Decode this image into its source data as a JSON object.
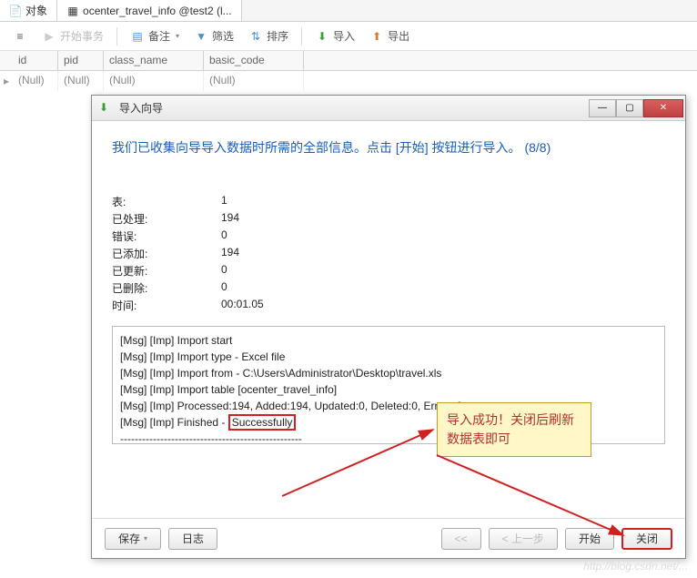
{
  "tabs": {
    "objects": "对象",
    "table": "ocenter_travel_info @test2 (l..."
  },
  "toolbar": {
    "menu": "≡",
    "begin_tx": "开始事务",
    "memo": "备注",
    "filter": "筛选",
    "sort": "排序",
    "import": "导入",
    "export": "导出"
  },
  "grid": {
    "cols": [
      "id",
      "pid",
      "class_name",
      "basic_code"
    ],
    "null_text": "(Null)"
  },
  "dialog": {
    "title": "导入向导",
    "headline": "我们已收集向导导入数据时所需的全部信息。点击 [开始] 按钮进行导入。 (8/8)",
    "stats": {
      "table_label": "表:",
      "table_value": "1",
      "processed_label": "已处理:",
      "processed_value": "194",
      "error_label": "错误:",
      "error_value": "0",
      "added_label": "已添加:",
      "added_value": "194",
      "updated_label": "已更新:",
      "updated_value": "0",
      "deleted_label": "已删除:",
      "deleted_value": "0",
      "time_label": "时间:",
      "time_value": "00:01.05"
    },
    "log": {
      "l1": "[Msg] [Imp] Import start",
      "l2": "[Msg] [Imp] Import type - Excel file",
      "l3": "[Msg] [Imp] Import from - C:\\Users\\Administrator\\Desktop\\travel.xls",
      "l4": "[Msg] [Imp] Import table [ocenter_travel_info]",
      "l5": "[Msg] [Imp] Processed:194, Added:194, Updated:0, Deleted:0, Errors:0",
      "l6a": "[Msg] [Imp] Finished - ",
      "l6b": "Successfully",
      "dashes": "--------------------------------------------------"
    },
    "buttons": {
      "save": "保存",
      "log": "日志",
      "first": "<<",
      "prev": "< 上一步",
      "start": "开始",
      "close": "关闭"
    }
  },
  "callout": "导入成功！关闭后刷新数据表即可",
  "watermark": "http://blog.csdn.net/..."
}
